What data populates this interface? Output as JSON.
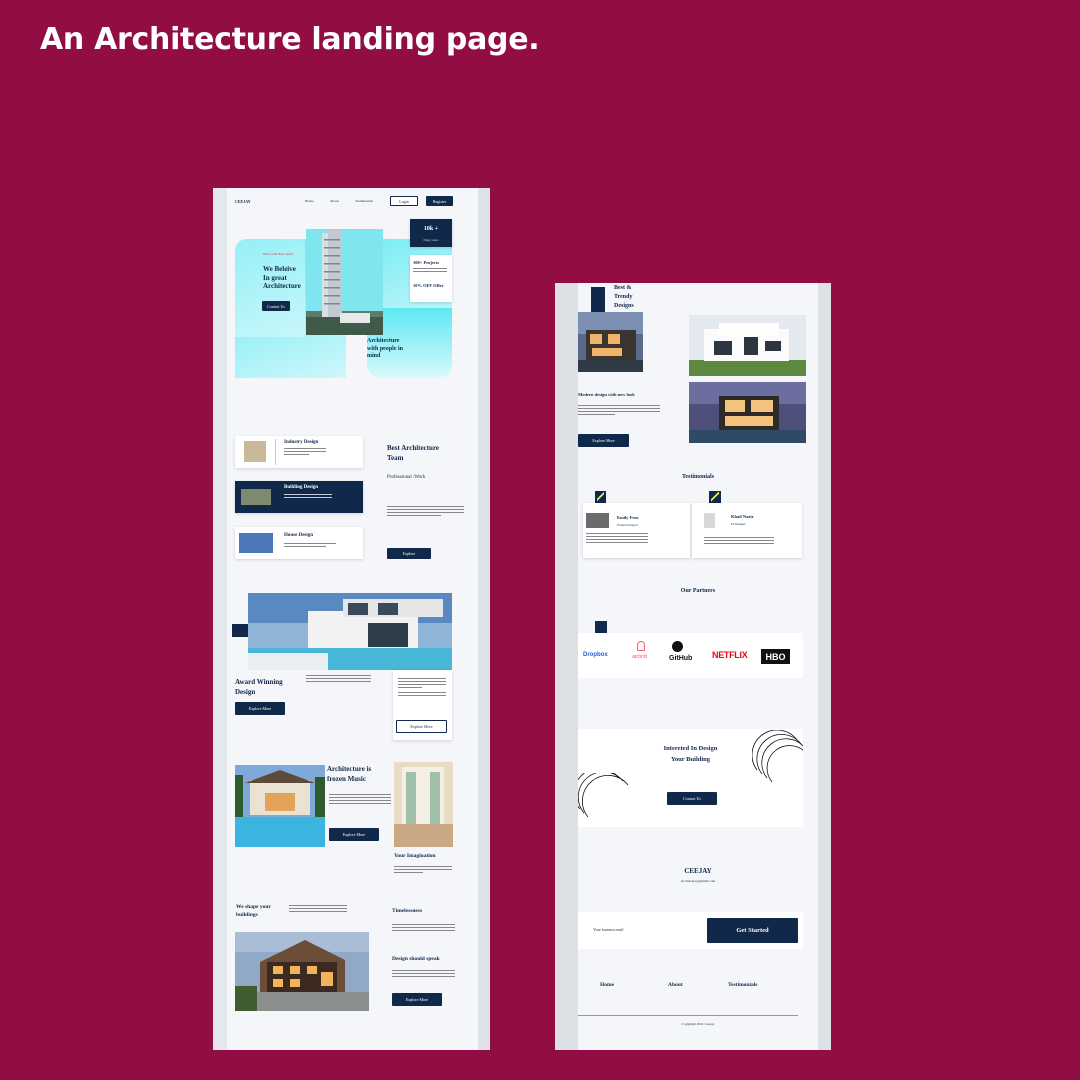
{
  "headline": "An Architecture landing page.",
  "left": {
    "nav": {
      "brand": "CEEJAY",
      "links": [
        "Home",
        "About",
        "Testimonials"
      ],
      "login": "Login",
      "register": "Register"
    },
    "hero": {
      "eyebrow": "Meet with Best Team",
      "title_lines": [
        "We Beleive",
        "In great",
        "Architecture"
      ],
      "cta": "Contact Us",
      "stat_value": "10k +",
      "stat_label": "Happy users",
      "projects": "100+ Projects",
      "offer": "10% OFF Offer",
      "tagline_lines": [
        "Architecture",
        "with people in",
        "mind"
      ]
    },
    "services": [
      {
        "title": "Industry Design"
      },
      {
        "title": "Building Design"
      },
      {
        "title": "House Design"
      }
    ],
    "team": {
      "title_lines": [
        "Best Architecture",
        "Team"
      ],
      "subtitle": "Professional /Work",
      "button": "Explore"
    },
    "award": {
      "title_lines": [
        "Award Winning",
        "Design"
      ],
      "button": "Explore More",
      "button2": "Explore More"
    },
    "frozen": {
      "title_lines": [
        "Architecture is",
        "frozen Music"
      ],
      "button": "Explore More",
      "imagination": "Your Imagination"
    },
    "shape": {
      "title_lines": [
        "We shape your",
        "buildings"
      ],
      "timelessness": "Timelessness",
      "speak": "Design should speak",
      "button": "Explore More"
    }
  },
  "right": {
    "trendy_lines": [
      "Best &",
      "Trendy",
      "Designs"
    ],
    "modern_title": "Modern design with new look",
    "explore": "Explore More",
    "testimonials_title": "Testimonials",
    "testimonials": [
      {
        "name": "Emily Fero",
        "role": "Product Designer"
      },
      {
        "name": "Khail Nazir",
        "role": "UI Designer"
      }
    ],
    "partners_title": "Our Partners",
    "partners": [
      "Dropbox",
      "airbnb",
      "GitHub",
      "NETFLIX",
      "HBO"
    ],
    "cta_lines": [
      "Intereted In Design",
      "Your Building"
    ],
    "cta_button": "Contact Us",
    "brand": "CEEJAY",
    "email": "jacobdokoy@gmail.com",
    "email_placeholder": "Your business mail",
    "get_started": "Get Started",
    "footer_links": [
      "Home",
      "About",
      "Testimonials"
    ],
    "copyright": "Copyright 2021 Ceejay"
  },
  "colors": {
    "background": "#930d45",
    "navy": "#10284a",
    "cyan": "#5de8f2"
  }
}
